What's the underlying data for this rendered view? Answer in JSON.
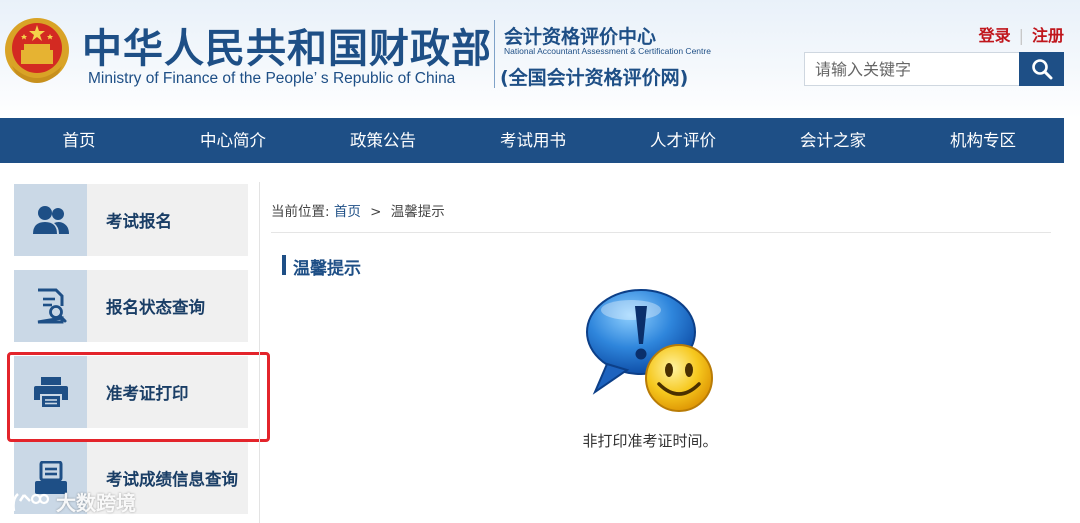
{
  "header": {
    "title_cn": "中华人民共和国财政部",
    "title_en": "Ministry of Finance of the People’ s Republic of China",
    "center_name": "会计资格评价中心",
    "center_en": "National Accountant Assessment & Certification Centre",
    "center_net": "(全国会计资格评价网)",
    "login": "登录",
    "register": "注册",
    "search_placeholder": "请输入关键字"
  },
  "nav": {
    "items": [
      {
        "label": "首页"
      },
      {
        "label": "中心简介"
      },
      {
        "label": "政策公告"
      },
      {
        "label": "考试用书"
      },
      {
        "label": "人才评价"
      },
      {
        "label": "会计之家"
      },
      {
        "label": "机构专区"
      }
    ]
  },
  "sidebar": {
    "items": [
      {
        "label": "考试报名",
        "icon": "users-icon"
      },
      {
        "label": "报名状态查询",
        "icon": "document-search-icon"
      },
      {
        "label": "准考证打印",
        "icon": "printer-icon"
      },
      {
        "label": "考试成绩信息查询",
        "icon": "score-report-icon"
      }
    ]
  },
  "breadcrumb": {
    "prefix": "当前位置:",
    "home": "首页",
    "separator": ">",
    "current": "温馨提示"
  },
  "main": {
    "section_title": "温馨提示",
    "message": "非打印准考证时间。"
  },
  "watermark": {
    "text": "大数跨境"
  },
  "colors": {
    "brand_blue": "#1e4f86",
    "nav_blue": "#1e4f86",
    "link_red": "#c0161c",
    "highlight_red": "#e3242b",
    "icon_tile": "#cad8e6"
  }
}
